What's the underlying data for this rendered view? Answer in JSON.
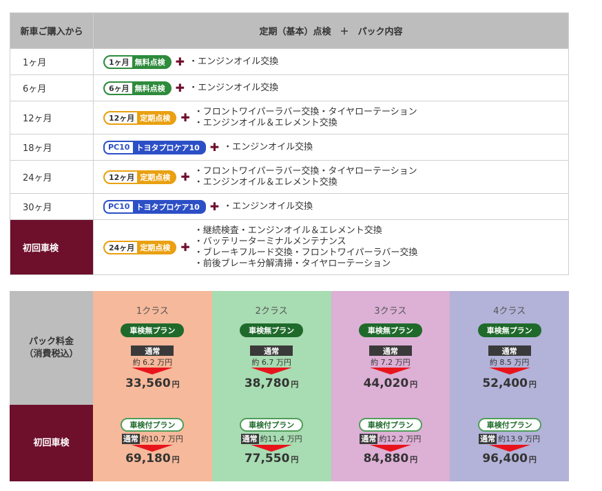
{
  "table": {
    "header_col1": "新車ご購入から",
    "header_col2": "定期（基本）点検　＋　パック内容",
    "rows": [
      {
        "month": "1ヶ月",
        "badge_label": "1ヶ月",
        "badge_text": "無料点検",
        "items": [
          "・エンジンオイル交換"
        ]
      },
      {
        "month": "6ヶ月",
        "badge_label": "6ヶ月",
        "badge_text": "無料点検",
        "items": [
          "・エンジンオイル交換"
        ]
      },
      {
        "month": "12ヶ月",
        "badge_label": "12ヶ月",
        "badge_text": "定期点検",
        "items": [
          "・フロントワイパーラバー交換・タイヤローテーション",
          "・エンジンオイル＆エレメント交換"
        ]
      },
      {
        "month": "18ヶ月",
        "badge_label": "PC10",
        "badge_text": "トヨタプロケア10",
        "items": [
          "・エンジンオイル交換"
        ]
      },
      {
        "month": "24ヶ月",
        "badge_label": "12ヶ月",
        "badge_text": "定期点検",
        "items": [
          "・フロントワイパーラバー交換・タイヤローテーション",
          "・エンジンオイル＆エレメント交換"
        ]
      },
      {
        "month": "30ヶ月",
        "badge_label": "PC10",
        "badge_text": "トヨタプロケア10",
        "items": [
          "・エンジンオイル交換"
        ]
      },
      {
        "month": "初回車検",
        "badge_label": "24ヶ月",
        "badge_text": "定期点検",
        "items": [
          "・継続検査・エンジンオイル＆エレメント交換",
          "・バッテリーターミナルメンテナンス",
          "・ブレーキフルード交換・フロントワイパーラバー交換",
          "・前後ブレーキ分解清掃・タイヤローテーション"
        ]
      }
    ]
  },
  "price": {
    "side_pack_line1": "パック料金",
    "side_pack_line2": "（消費税込）",
    "side_first": "初回車検",
    "yen": "円",
    "normal_label": "通常",
    "plan_no_inspection": "車検無プラン",
    "plan_with_inspection": "車検付プラン",
    "classes": [
      {
        "name": "1クラス",
        "approx1": "約 6.2 万円",
        "price1": "33,560",
        "approx2": "約10.7 万円",
        "price2": "69,180",
        "color": "#f6b99b"
      },
      {
        "name": "2クラス",
        "approx1": "約 6.7 万円",
        "price1": "38,780",
        "approx2": "約11.4 万円",
        "price2": "77,550",
        "color": "#a8dcb2"
      },
      {
        "name": "3クラス",
        "approx1": "約 7.2 万円",
        "price1": "44,020",
        "approx2": "約12.2 万円",
        "price2": "84,880",
        "color": "#ddb0d6"
      },
      {
        "name": "4クラス",
        "approx1": "約 8.5 万円",
        "price1": "52,400",
        "approx2": "約13.9 万円",
        "price2": "96,400",
        "color": "#b3b2d8"
      }
    ]
  },
  "colors": {
    "maroon": "#6e0f2c",
    "green_badge": "#2e8b3c",
    "orange_badge": "#e9a011",
    "blue_badge": "#2c4fc6",
    "arrow_red": "#e8141c"
  }
}
